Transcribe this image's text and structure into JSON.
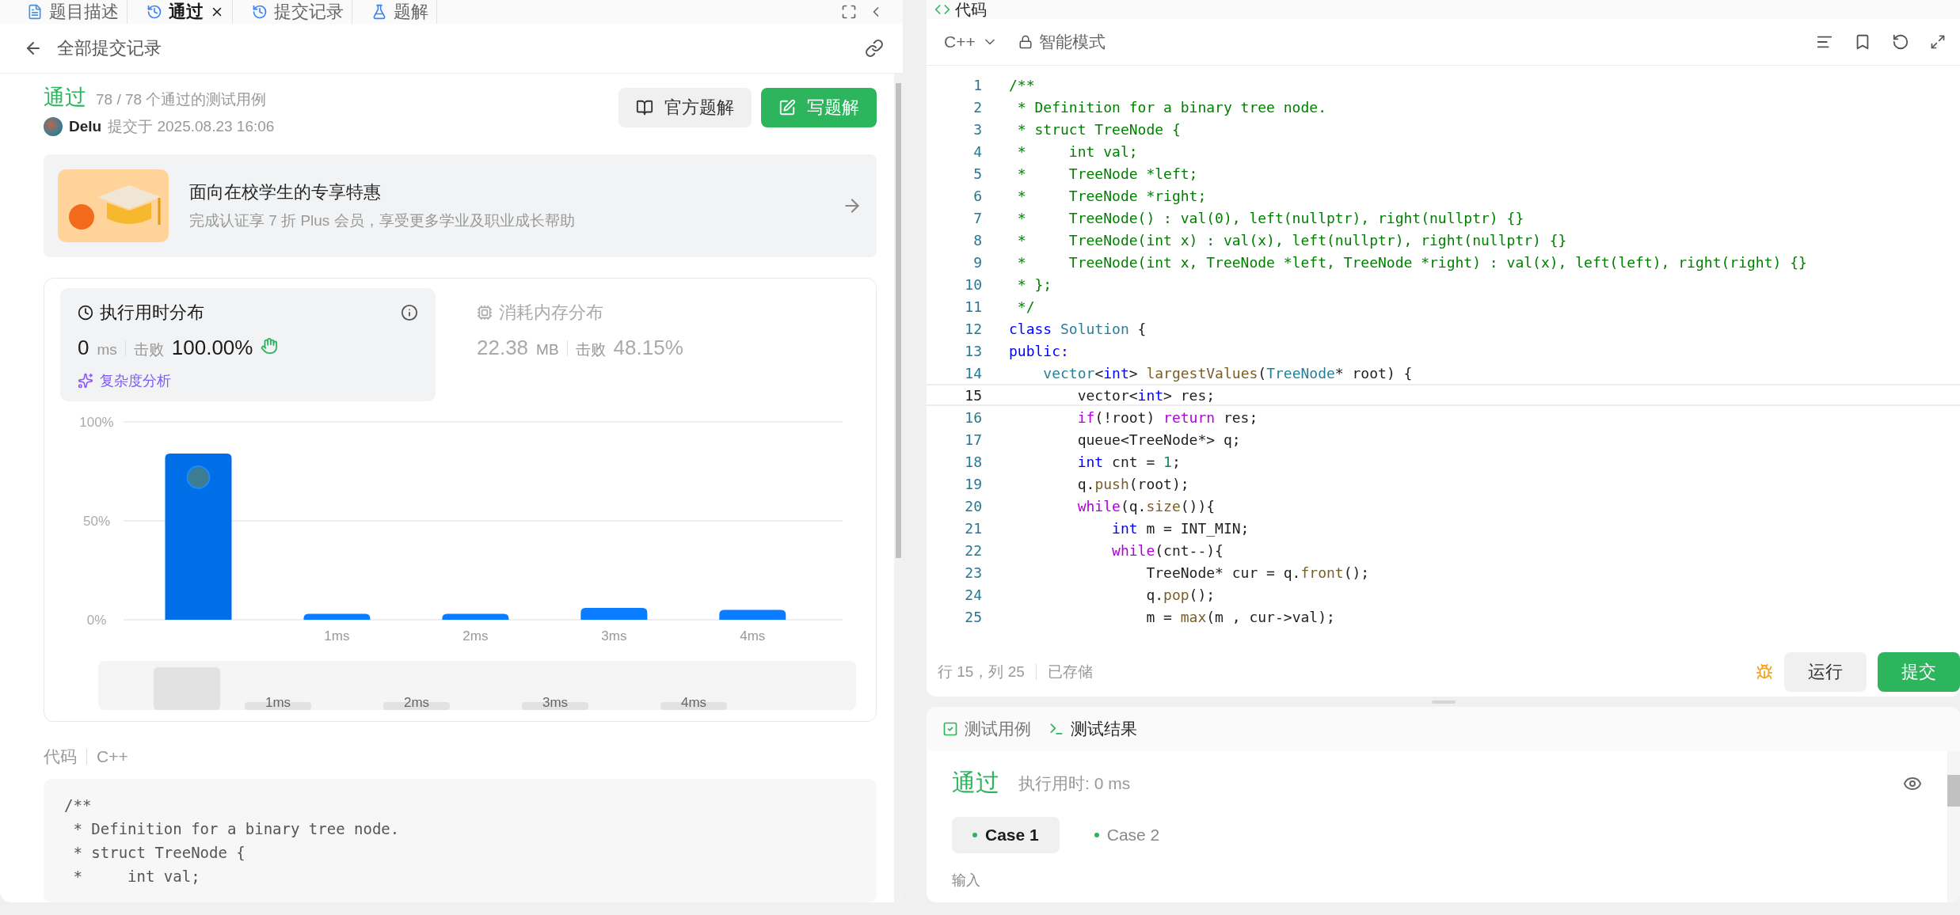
{
  "left_tabs": [
    {
      "label": "题目描述",
      "selected": false,
      "closable": false
    },
    {
      "label": "通过",
      "selected": true,
      "closable": true
    },
    {
      "label": "提交记录",
      "selected": false,
      "closable": false
    },
    {
      "label": "题解",
      "selected": false,
      "closable": false
    }
  ],
  "right_tab": {
    "label": "代码"
  },
  "submission": {
    "back_label": "全部提交记录",
    "status": "通过",
    "tests": "78 / 78 个通过的测试用例",
    "user": "Delu",
    "submitted": "提交于 2025.08.23 16:06",
    "buttons": [
      {
        "label": "官方题解",
        "kind": "secondary"
      },
      {
        "label": "写题解",
        "kind": "primary"
      }
    ]
  },
  "promo": {
    "title": "面向在校学生的专享特惠",
    "subtitle": "完成认证享 7 折 Plus 会员，享受更多学业及职业成长帮助"
  },
  "stats": [
    {
      "title": "执行用时分布",
      "selected": true,
      "value": "0",
      "unit": "ms",
      "beat_label": "击败",
      "beat": "100.00%",
      "link": "复杂度分析"
    },
    {
      "title": "消耗内存分布",
      "selected": false,
      "value": "22.38",
      "unit": "MB",
      "beat_label": "击败",
      "beat": "48.15%"
    }
  ],
  "chart_data": {
    "type": "bar",
    "x": [
      0,
      1,
      2,
      3,
      4
    ],
    "values": [
      84,
      3,
      3,
      6,
      5
    ],
    "xlim": [
      -0.54,
      4.65
    ],
    "ylim": [
      0,
      100
    ],
    "yticks": [
      {
        "value": 0,
        "label": "0%"
      },
      {
        "value": 50,
        "label": "50%"
      },
      {
        "value": 100,
        "label": "100%"
      }
    ],
    "xticks": [
      {
        "value": 1,
        "label": "1ms"
      },
      {
        "value": 2,
        "label": "2ms"
      },
      {
        "value": 3,
        "label": "3ms"
      },
      {
        "value": 4,
        "label": "4ms"
      }
    ]
  },
  "brush_labels": [
    "1ms",
    "2ms",
    "3ms",
    "4ms"
  ],
  "code_header": {
    "label": "代码",
    "language": "C++"
  },
  "code_preview": [
    "/**",
    " * Definition for a binary tree node.",
    " * struct TreeNode {",
    " *     int val;"
  ],
  "editor": {
    "language": "C++",
    "mode": "智能模式",
    "lines": [
      {
        "number": "1",
        "highlighted": false,
        "tokens": [
          {
            "text": "/**",
            "kind": "comment"
          }
        ]
      },
      {
        "number": "2",
        "highlighted": false,
        "tokens": [
          {
            "text": " * Definition for a binary tree node.",
            "kind": "comment"
          }
        ]
      },
      {
        "number": "3",
        "highlighted": false,
        "tokens": [
          {
            "text": " * struct TreeNode {",
            "kind": "comment"
          }
        ]
      },
      {
        "number": "4",
        "highlighted": false,
        "tokens": [
          {
            "text": " *     int val;",
            "kind": "comment"
          }
        ]
      },
      {
        "number": "5",
        "highlighted": false,
        "tokens": [
          {
            "text": " *     TreeNode *left;",
            "kind": "comment"
          }
        ]
      },
      {
        "number": "6",
        "highlighted": false,
        "tokens": [
          {
            "text": " *     TreeNode *right;",
            "kind": "comment"
          }
        ]
      },
      {
        "number": "7",
        "highlighted": false,
        "tokens": [
          {
            "text": " *     TreeNode() : val(0), left(nullptr), right(nullptr) {}",
            "kind": "comment"
          }
        ]
      },
      {
        "number": "8",
        "highlighted": false,
        "tokens": [
          {
            "text": " *     TreeNode(int x) : val(x), left(nullptr), right(nullptr) {}",
            "kind": "comment"
          }
        ]
      },
      {
        "number": "9",
        "highlighted": false,
        "tokens": [
          {
            "text": " *     TreeNode(int x, TreeNode *left, TreeNode *right) : val(x), left(left), right(right) {}",
            "kind": "comment"
          }
        ]
      },
      {
        "number": "10",
        "highlighted": false,
        "tokens": [
          {
            "text": " * };",
            "kind": "comment"
          }
        ]
      },
      {
        "number": "11",
        "highlighted": false,
        "tokens": [
          {
            "text": " */",
            "kind": "comment"
          }
        ]
      },
      {
        "number": "12",
        "highlighted": false,
        "tokens": [
          {
            "text": "class ",
            "kind": "keyword"
          },
          {
            "text": "Solution",
            "kind": "type"
          },
          {
            "text": " {",
            "kind": "plain"
          }
        ]
      },
      {
        "number": "13",
        "highlighted": false,
        "tokens": [
          {
            "text": "public:",
            "kind": "keyword"
          }
        ]
      },
      {
        "number": "14",
        "highlighted": false,
        "tokens": [
          {
            "text": "    vector",
            "kind": "type"
          },
          {
            "text": "<",
            "kind": "plain"
          },
          {
            "text": "int",
            "kind": "keyword"
          },
          {
            "text": "> ",
            "kind": "plain"
          },
          {
            "text": "largestValues",
            "kind": "func"
          },
          {
            "text": "(",
            "kind": "plain"
          },
          {
            "text": "TreeNode",
            "kind": "type"
          },
          {
            "text": "* root) {",
            "kind": "plain"
          }
        ]
      },
      {
        "number": "15",
        "highlighted": true,
        "tokens": [
          {
            "text": "        vector<",
            "kind": "plain"
          },
          {
            "text": "int",
            "kind": "keyword"
          },
          {
            "text": "> res;",
            "kind": "plain"
          }
        ]
      },
      {
        "number": "16",
        "highlighted": false,
        "tokens": [
          {
            "text": "        if",
            "kind": "control"
          },
          {
            "text": "(!root) ",
            "kind": "plain"
          },
          {
            "text": "return",
            "kind": "control"
          },
          {
            "text": " res;",
            "kind": "plain"
          }
        ]
      },
      {
        "number": "17",
        "highlighted": false,
        "tokens": [
          {
            "text": "        queue<TreeNode*> q;",
            "kind": "plain"
          }
        ]
      },
      {
        "number": "18",
        "highlighted": false,
        "tokens": [
          {
            "text": "        int",
            "kind": "keyword"
          },
          {
            "text": " cnt = ",
            "kind": "plain"
          },
          {
            "text": "1",
            "kind": "number"
          },
          {
            "text": ";",
            "kind": "plain"
          }
        ]
      },
      {
        "number": "19",
        "highlighted": false,
        "tokens": [
          {
            "text": "        q.",
            "kind": "plain"
          },
          {
            "text": "push",
            "kind": "func"
          },
          {
            "text": "(root);",
            "kind": "plain"
          }
        ]
      },
      {
        "number": "20",
        "highlighted": false,
        "tokens": [
          {
            "text": "        while",
            "kind": "control"
          },
          {
            "text": "(q.",
            "kind": "plain"
          },
          {
            "text": "size",
            "kind": "func"
          },
          {
            "text": "()){",
            "kind": "plain"
          }
        ]
      },
      {
        "number": "21",
        "highlighted": false,
        "tokens": [
          {
            "text": "            int",
            "kind": "keyword"
          },
          {
            "text": " m = INT_MIN;",
            "kind": "plain"
          }
        ]
      },
      {
        "number": "22",
        "highlighted": false,
        "tokens": [
          {
            "text": "            while",
            "kind": "control"
          },
          {
            "text": "(cnt--){",
            "kind": "plain"
          }
        ]
      },
      {
        "number": "23",
        "highlighted": false,
        "tokens": [
          {
            "text": "                TreeNode* cur = q.",
            "kind": "plain"
          },
          {
            "text": "front",
            "kind": "func"
          },
          {
            "text": "();",
            "kind": "plain"
          }
        ]
      },
      {
        "number": "24",
        "highlighted": false,
        "tokens": [
          {
            "text": "                q.",
            "kind": "plain"
          },
          {
            "text": "pop",
            "kind": "func"
          },
          {
            "text": "();",
            "kind": "plain"
          }
        ]
      },
      {
        "number": "25",
        "highlighted": false,
        "tokens": [
          {
            "text": "                m = ",
            "kind": "plain"
          },
          {
            "text": "max",
            "kind": "func"
          },
          {
            "text": "(m , cur->val);",
            "kind": "plain"
          }
        ]
      }
    ],
    "position": "行 15，列 25",
    "saved": "已存储",
    "buttons": [
      {
        "label": "运行",
        "kind": "secondary"
      },
      {
        "label": "提交",
        "kind": "primary"
      }
    ]
  },
  "bottom_tabs": [
    {
      "label": "测试用例",
      "selected": false
    },
    {
      "label": "测试结果",
      "selected": true
    }
  ],
  "result": {
    "status": "通过",
    "runtime": "执行用时: 0 ms",
    "cases": [
      {
        "label": "Case 1",
        "selected": true
      },
      {
        "label": "Case 2",
        "selected": false
      }
    ],
    "input_label": "输入"
  }
}
